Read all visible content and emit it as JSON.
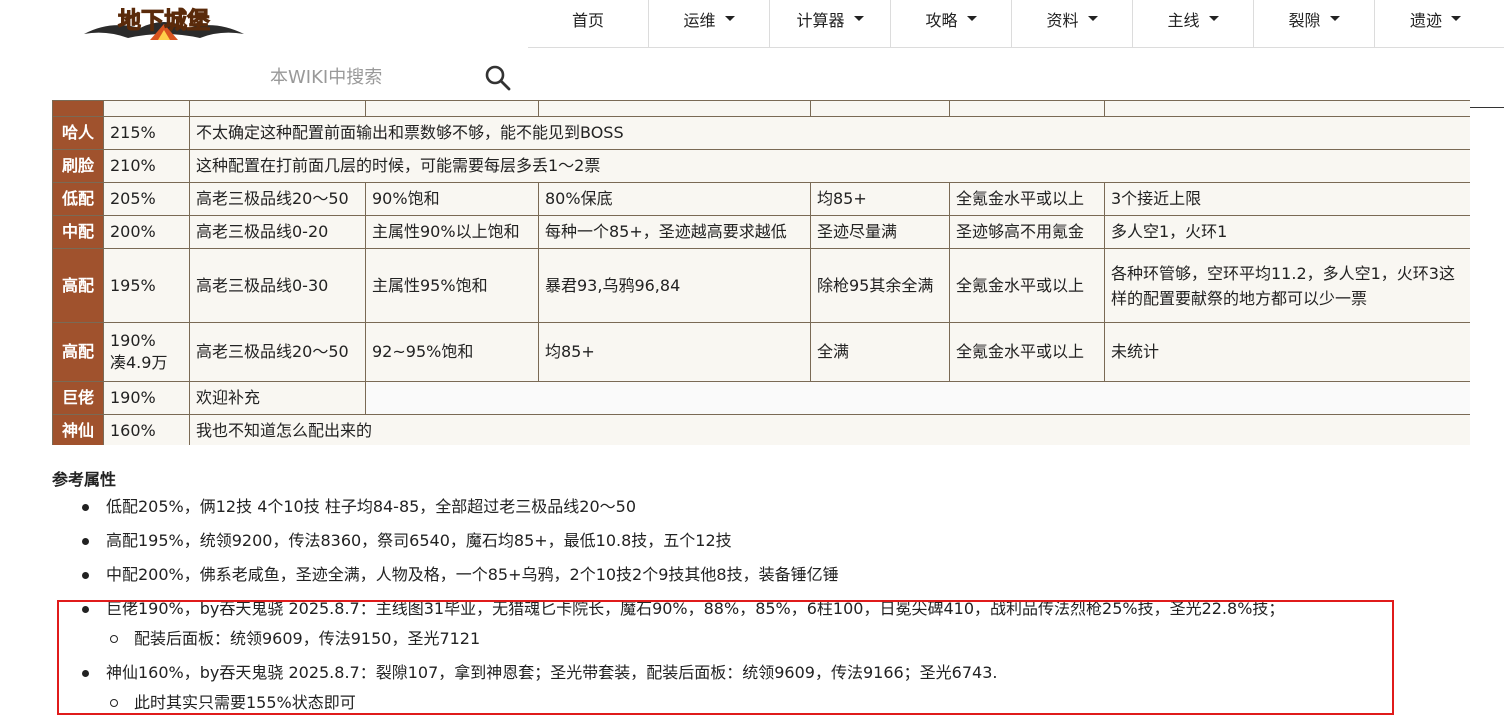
{
  "header": {
    "logo_text": "地下城堡",
    "nav": [
      {
        "label": "首页",
        "has_dropdown": false
      },
      {
        "label": "运维",
        "has_dropdown": true
      },
      {
        "label": "计算器",
        "has_dropdown": true
      },
      {
        "label": "攻略",
        "has_dropdown": true
      },
      {
        "label": "资料",
        "has_dropdown": true
      },
      {
        "label": "主线",
        "has_dropdown": true
      },
      {
        "label": "裂隙",
        "has_dropdown": true
      },
      {
        "label": "遗迹",
        "has_dropdown": true
      }
    ],
    "search": {
      "placeholder": "本WIKI中搜索",
      "icon": "search-icon"
    }
  },
  "table": {
    "rows": [
      {
        "level": "哈人",
        "rate": "215%",
        "note": "不太确定这种配置前面输出和票数够不够，能不能见到BOSS"
      },
      {
        "level": "刷脸",
        "rate": "210%",
        "note": "这种配置在打前面几层的时候，可能需要每层多丢1～2票"
      },
      {
        "level": "低配",
        "rate": "205%",
        "cells": [
          "高老三极品线20～50",
          "90%饱和",
          "80%保底",
          "均85+",
          "全氪金水平或以上",
          "3个接近上限"
        ]
      },
      {
        "level": "中配",
        "rate": "200%",
        "cells": [
          "高老三极品线0-20",
          "主属性90%以上饱和",
          "每种一个85+，圣迹越高要求越低",
          "圣迹尽量满",
          "圣迹够高不用氪金",
          "多人空1，火环1"
        ]
      },
      {
        "level": "高配",
        "rate": "195%",
        "cells": [
          "高老三极品线0-30",
          "主属性95%饱和",
          "暴君93,乌鸦96,84",
          "除枪95其余全满",
          "全氪金水平或以上",
          "各种环管够，空环平均11.2，多人空1，火环3这样的配置要献祭的地方都可以少一票"
        ]
      },
      {
        "level": "高配",
        "rate_line1": "190%",
        "rate_line2": "凑4.9万",
        "cells": [
          "高老三极品线20～50",
          "92~95%饱和",
          "均85+",
          "全满",
          "全氪金水平或以上",
          "未统计"
        ]
      },
      {
        "level": "巨佬",
        "rate": "190%",
        "note": "欢迎补充"
      },
      {
        "level": "神仙",
        "rate": "160%",
        "note": "我也不知道怎么配出来的"
      }
    ]
  },
  "reference": {
    "title": "参考属性",
    "items": [
      {
        "text": "低配205%，俩12技 4个10技 柱子均84-85，全部超过老三极品线20～50"
      },
      {
        "text": "高配195%，统领9200，传法8360，祭司6540，魔石均85+，最低10.8技，五个12技"
      },
      {
        "text": "中配200%，佛系老咸鱼，圣迹全满，人物及格，一个85+乌鸦，2个10技2个9技其他8技，装备锤亿锤"
      },
      {
        "text": "巨佬190%，by吞天鬼骁 2025.8.7：主线图31毕业，无猎魂匕卡院长，魔石90%，88%，85%，6柱100，日冕尖碑410，战利品传法烈枪25%技，圣光22.8%技；",
        "sub": "配装后面板：统领9609，传法9150，圣光7121"
      },
      {
        "text": "神仙160%，by吞天鬼骁 2025.8.7：裂隙107，拿到神恩套；圣光带套装，配装后面板：统领9609，传法9166；圣光6743.",
        "sub": "此时其实只需要155%状态即可"
      }
    ]
  },
  "colors": {
    "level_cell_bg": "#a0522d",
    "table_border": "#7a6a55",
    "highlight_border": "#e01b1b"
  }
}
